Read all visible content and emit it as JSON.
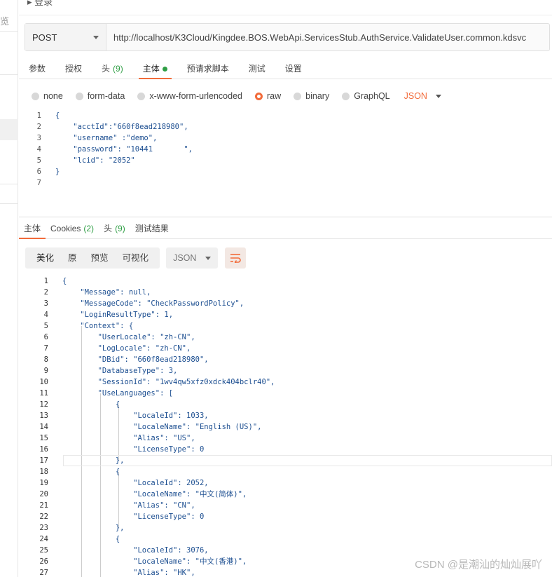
{
  "left": {
    "glyph": "览"
  },
  "breadcrumb": "▸ 登录",
  "request": {
    "method": "POST",
    "url": "http://localhost/K3Cloud/Kingdee.BOS.WebApi.ServicesStub.AuthService.ValidateUser.common.kdsvc"
  },
  "req_tabs": [
    {
      "label": "参数"
    },
    {
      "label": "授权"
    },
    {
      "label": "头",
      "count": "(9)"
    },
    {
      "label": "主体",
      "dot": true,
      "active": true
    },
    {
      "label": "预请求脚本"
    },
    {
      "label": "测试"
    },
    {
      "label": "设置"
    }
  ],
  "body_types": [
    "none",
    "form-data",
    "x-www-form-urlencoded",
    "raw",
    "binary",
    "GraphQL"
  ],
  "body_type_selected": "raw",
  "body_format": "JSON",
  "request_body": [
    "{",
    "    \"acctId\":\"660f8ead218980\",",
    "    \"username\" :\"demo\",",
    "    \"password\": \"10441       \",",
    "    \"lcid\": \"2052\"",
    "}",
    ""
  ],
  "res_tabs": [
    {
      "label": "主体",
      "active": true
    },
    {
      "label": "Cookies",
      "count": "(2)"
    },
    {
      "label": "头",
      "count": "(9)"
    },
    {
      "label": "测试结果"
    }
  ],
  "view_modes": [
    "美化",
    "原",
    "预览",
    "可视化"
  ],
  "view_format": "JSON",
  "response_body": [
    "{",
    "    \"Message\": null,",
    "    \"MessageCode\": \"CheckPasswordPolicy\",",
    "    \"LoginResultType\": 1,",
    "    \"Context\": {",
    "        \"UserLocale\": \"zh-CN\",",
    "        \"LogLocale\": \"zh-CN\",",
    "        \"DBid\": \"660f8ead218980\",",
    "        \"DatabaseType\": 3,",
    "        \"SessionId\": \"1wv4qw5xfz0xdck404bclr40\",",
    "        \"UseLanguages\": [",
    "            {",
    "                \"LocaleId\": 1033,",
    "                \"LocaleName\": \"English (US)\",",
    "                \"Alias\": \"US\",",
    "                \"LicenseType\": 0",
    "            },",
    "            {",
    "                \"LocaleId\": 2052,",
    "                \"LocaleName\": \"中文(简体)\",",
    "                \"Alias\": \"CN\",",
    "                \"LicenseType\": 0",
    "            },",
    "            {",
    "                \"LocaleId\": 3076,",
    "                \"LocaleName\": \"中文(香港)\",",
    "                \"Alias\": \"HK\","
  ],
  "watermark": "CSDN @是潮汕的灿灿展吖",
  "colors": {
    "accent": "#f26b3a",
    "green": "#2e9e44"
  }
}
